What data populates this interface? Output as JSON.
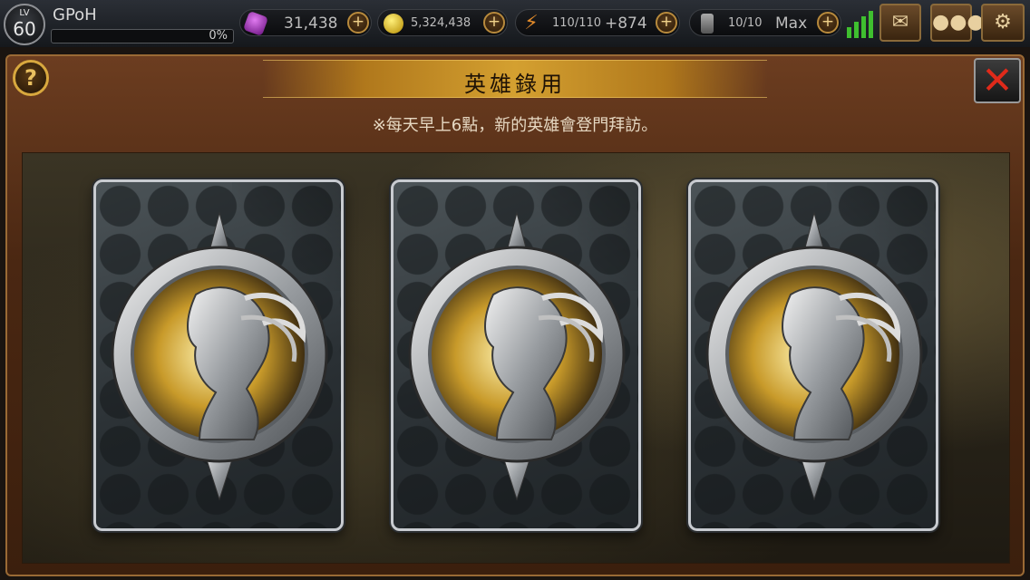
{
  "hud": {
    "level_label": "LV",
    "level": "60",
    "player_name": "GPoH",
    "exp_percent_text": "0%",
    "exp_fraction": 0,
    "gems": "31,438",
    "gold": "5,324,438",
    "stamina": "110/110",
    "stamina_bonus": "+874",
    "tickets": "10/10",
    "tickets_status": "Max",
    "plus": "+"
  },
  "panel": {
    "title": "英雄錄用",
    "notice": "※每天早上6點，新的英雄會登門拜訪。",
    "help_icon": "?",
    "close_icon": "✕"
  },
  "cards": [
    {
      "state": "face-down"
    },
    {
      "state": "face-down"
    },
    {
      "state": "face-down"
    }
  ],
  "colors": {
    "accent_gold": "#d4a030",
    "close_red": "#e02a1a",
    "signal_green": "#3fbf2f"
  },
  "icons": [
    "gem-icon",
    "gold-coin-icon",
    "stamina-bolt-icon",
    "ticket-scroll-icon",
    "signal-icon",
    "mail-icon",
    "chat-icon",
    "settings-gear-icon",
    "help-icon",
    "close-icon",
    "hero-emblem-icon"
  ]
}
